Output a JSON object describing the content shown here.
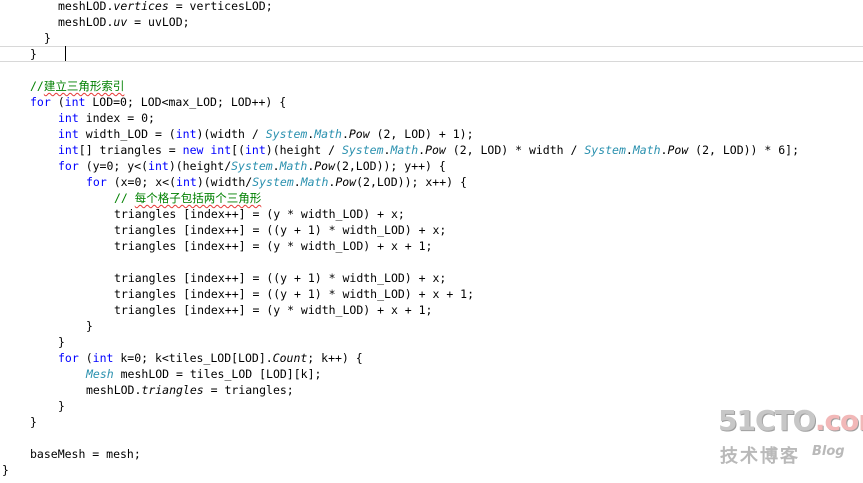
{
  "code_lines": [
    {
      "indent": "        ",
      "parts": [
        {
          "text": "meshLOD."
        },
        {
          "text": "vertices",
          "cls": "it"
        },
        {
          "text": " = verticesLOD;"
        }
      ]
    },
    {
      "indent": "        ",
      "parts": [
        {
          "text": "meshLOD."
        },
        {
          "text": "uv",
          "cls": "it"
        },
        {
          "text": " = uvLOD;"
        }
      ]
    },
    {
      "indent": "      ",
      "parts": [
        {
          "text": "}"
        }
      ]
    },
    {
      "indent": "    ",
      "parts": [
        {
          "text": "}"
        }
      ]
    },
    {
      "indent": "",
      "parts": []
    },
    {
      "indent": "    ",
      "parts": [
        {
          "text": "//",
          "cls": "cm"
        },
        {
          "text": "建立三角形索引",
          "cls": "cm sq"
        }
      ]
    },
    {
      "indent": "    ",
      "parts": [
        {
          "text": "for",
          "cls": "kw"
        },
        {
          "text": " ("
        },
        {
          "text": "int",
          "cls": "kw"
        },
        {
          "text": " LOD=0; LOD<max_LOD; LOD++) {"
        }
      ]
    },
    {
      "indent": "        ",
      "parts": [
        {
          "text": "int",
          "cls": "kw"
        },
        {
          "text": " index = 0;"
        }
      ]
    },
    {
      "indent": "        ",
      "parts": [
        {
          "text": "int",
          "cls": "kw"
        },
        {
          "text": " width_LOD = ("
        },
        {
          "text": "int",
          "cls": "kw"
        },
        {
          "text": ")(width / "
        },
        {
          "text": "System",
          "cls": "ty"
        },
        {
          "text": "."
        },
        {
          "text": "Math",
          "cls": "ty"
        },
        {
          "text": "."
        },
        {
          "text": "Pow",
          "cls": "it"
        },
        {
          "text": " (2, LOD) + 1);"
        }
      ]
    },
    {
      "indent": "        ",
      "parts": [
        {
          "text": "int",
          "cls": "kw"
        },
        {
          "text": "[] triangles = "
        },
        {
          "text": "new",
          "cls": "kw"
        },
        {
          "text": " "
        },
        {
          "text": "int",
          "cls": "kw"
        },
        {
          "text": "[("
        },
        {
          "text": "int",
          "cls": "kw"
        },
        {
          "text": ")(height / "
        },
        {
          "text": "System",
          "cls": "ty"
        },
        {
          "text": "."
        },
        {
          "text": "Math",
          "cls": "ty"
        },
        {
          "text": "."
        },
        {
          "text": "Pow",
          "cls": "it"
        },
        {
          "text": " (2, LOD) * width / "
        },
        {
          "text": "System",
          "cls": "ty"
        },
        {
          "text": "."
        },
        {
          "text": "Math",
          "cls": "ty"
        },
        {
          "text": "."
        },
        {
          "text": "Pow",
          "cls": "it"
        },
        {
          "text": " (2, LOD)) * 6];"
        }
      ]
    },
    {
      "indent": "        ",
      "parts": [
        {
          "text": "for",
          "cls": "kw"
        },
        {
          "text": " (y=0; y<("
        },
        {
          "text": "int",
          "cls": "kw"
        },
        {
          "text": ")(height/"
        },
        {
          "text": "System",
          "cls": "ty"
        },
        {
          "text": "."
        },
        {
          "text": "Math",
          "cls": "ty"
        },
        {
          "text": "."
        },
        {
          "text": "Pow",
          "cls": "it"
        },
        {
          "text": "(2,LOD)); y++) {"
        }
      ]
    },
    {
      "indent": "            ",
      "parts": [
        {
          "text": "for",
          "cls": "kw"
        },
        {
          "text": " (x=0; x<("
        },
        {
          "text": "int",
          "cls": "kw"
        },
        {
          "text": ")(width/"
        },
        {
          "text": "System",
          "cls": "ty"
        },
        {
          "text": "."
        },
        {
          "text": "Math",
          "cls": "ty"
        },
        {
          "text": "."
        },
        {
          "text": "Pow",
          "cls": "it"
        },
        {
          "text": "(2,LOD)); x++) {"
        }
      ]
    },
    {
      "indent": "                ",
      "parts": [
        {
          "text": "// ",
          "cls": "cm"
        },
        {
          "text": "每个格子包括两个三角形",
          "cls": "cm sq"
        }
      ]
    },
    {
      "indent": "                ",
      "parts": [
        {
          "text": "triangles [index++] = (y * width_LOD) + x;"
        }
      ]
    },
    {
      "indent": "                ",
      "parts": [
        {
          "text": "triangles [index++] = ((y + 1) * width_LOD) + x;"
        }
      ]
    },
    {
      "indent": "                ",
      "parts": [
        {
          "text": "triangles [index++] = (y * width_LOD) + x + 1;"
        }
      ]
    },
    {
      "indent": "",
      "parts": []
    },
    {
      "indent": "                ",
      "parts": [
        {
          "text": "triangles [index++] = ((y + 1) * width_LOD) + x;"
        }
      ]
    },
    {
      "indent": "                ",
      "parts": [
        {
          "text": "triangles [index++] = ((y + 1) * width_LOD) + x + 1;"
        }
      ]
    },
    {
      "indent": "                ",
      "parts": [
        {
          "text": "triangles [index++] = (y * width_LOD) + x + 1;"
        }
      ]
    },
    {
      "indent": "            ",
      "parts": [
        {
          "text": "}"
        }
      ]
    },
    {
      "indent": "        ",
      "parts": [
        {
          "text": "}"
        }
      ]
    },
    {
      "indent": "        ",
      "parts": [
        {
          "text": "for",
          "cls": "kw"
        },
        {
          "text": " ("
        },
        {
          "text": "int",
          "cls": "kw"
        },
        {
          "text": " k=0; k<tiles_LOD[LOD]."
        },
        {
          "text": "Count",
          "cls": "it"
        },
        {
          "text": "; k++) {"
        }
      ]
    },
    {
      "indent": "            ",
      "parts": [
        {
          "text": "Mesh",
          "cls": "ty"
        },
        {
          "text": " meshLOD = tiles_LOD [LOD][k];"
        }
      ]
    },
    {
      "indent": "            ",
      "parts": [
        {
          "text": "meshLOD."
        },
        {
          "text": "triangles",
          "cls": "it"
        },
        {
          "text": " = triangles;"
        }
      ]
    },
    {
      "indent": "        ",
      "parts": [
        {
          "text": "}"
        }
      ]
    },
    {
      "indent": "    ",
      "parts": [
        {
          "text": "}"
        }
      ]
    },
    {
      "indent": "",
      "parts": []
    },
    {
      "indent": "    ",
      "parts": [
        {
          "text": "baseMesh = mesh;"
        }
      ]
    },
    {
      "indent": "",
      "parts": [
        {
          "text": "}"
        }
      ]
    }
  ],
  "watermark": {
    "logo_main": "51CTO",
    "logo_suffix": ".com",
    "subtitle": "技术博客",
    "blog": "Blog"
  }
}
